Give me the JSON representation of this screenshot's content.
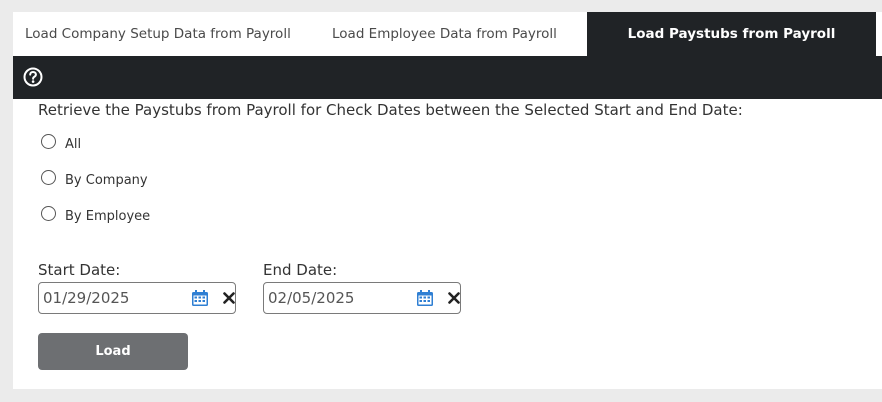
{
  "tabs": {
    "company": "Load Company Setup Data from Payroll",
    "employee": "Load Employee Data from Payroll",
    "paystubs": "Load Paystubs from Payroll"
  },
  "toolbar": {
    "help_icon": "question-circle-icon"
  },
  "instruction": "Retrieve the Paystubs from Payroll for Check Dates between the Selected Start and End Date:",
  "radio_options": [
    {
      "label": "All",
      "selected": false
    },
    {
      "label": "By Company",
      "selected": false
    },
    {
      "label": "By Employee",
      "selected": false
    }
  ],
  "start_date": {
    "label": "Start Date:",
    "value": "01/29/2025"
  },
  "end_date": {
    "label": "End Date:",
    "value": "02/05/2025"
  },
  "load_button": "Load",
  "colors": {
    "dark_bar": "#202326",
    "calendar_icon": "#2f7fd3",
    "button_bg": "#6d6f72",
    "page_bg": "#ebebeb"
  }
}
